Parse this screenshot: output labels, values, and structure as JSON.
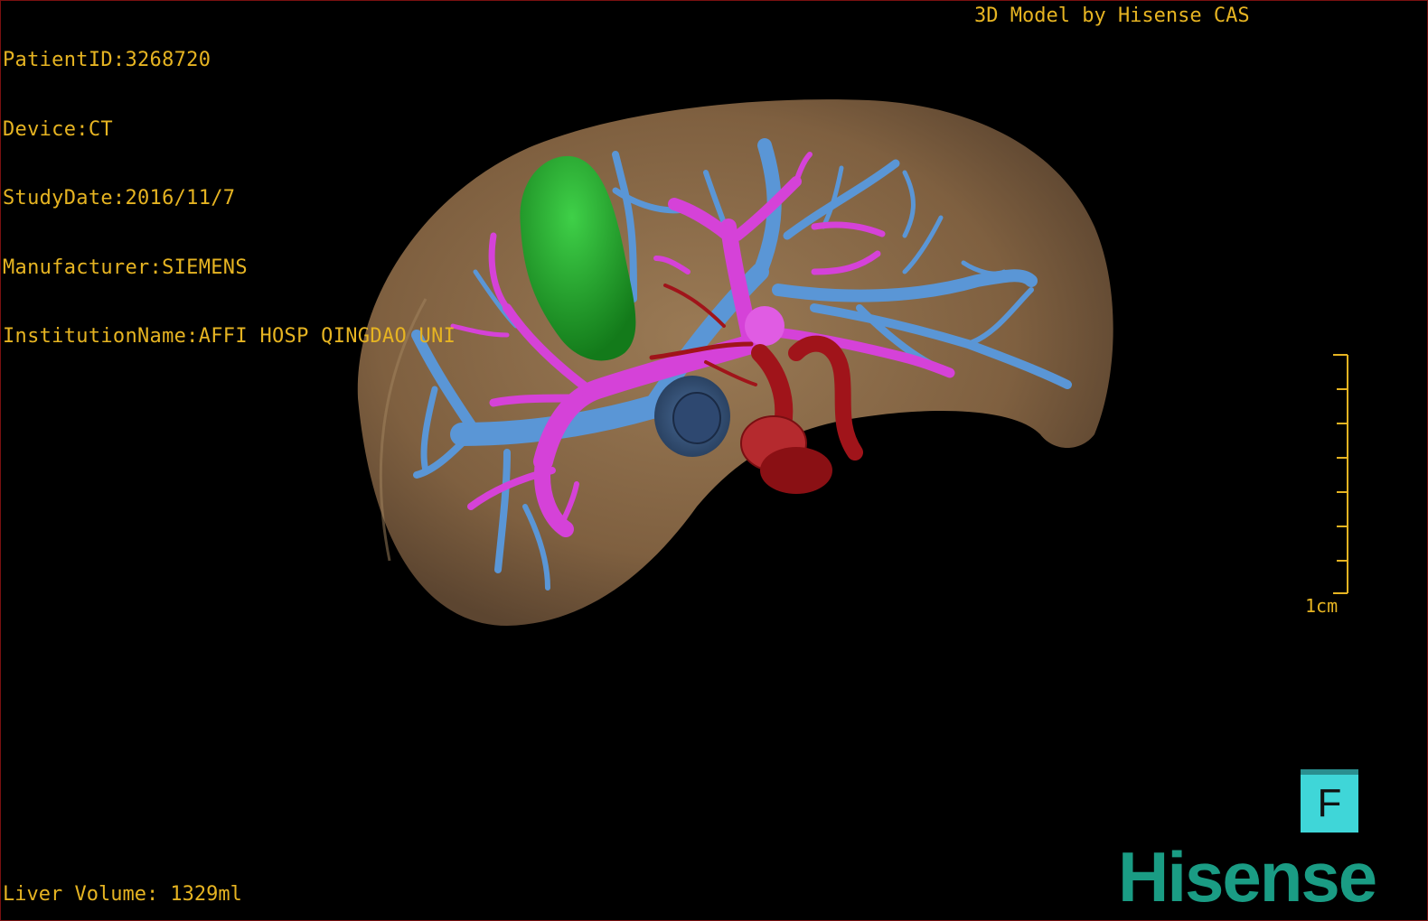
{
  "overlay": {
    "patient_id": "PatientID:3268720",
    "device": "Device:CT",
    "study_date": "StudyDate:2016/11/7",
    "manufacturer": "Manufacturer:SIEMENS",
    "institution": "InstitutionName:AFFI HOSP QINGDAO UNI",
    "credit": "3D Model by Hisense CAS",
    "liver_volume": "Liver Volume: 1329ml"
  },
  "scale_bar": {
    "label": "1cm"
  },
  "orientation": {
    "label": "F"
  },
  "brand": {
    "name": "Hisense"
  },
  "colors": {
    "overlay_text": "#e6b422",
    "liver": "#8b6a45",
    "gallbladder": "#22a52a",
    "portal_vein": "#d542d8",
    "hepatic_vein": "#5a96d6",
    "artery": "#a0141a",
    "orientation_cube": "#3fd6d8",
    "brand": "#1a9c84"
  }
}
